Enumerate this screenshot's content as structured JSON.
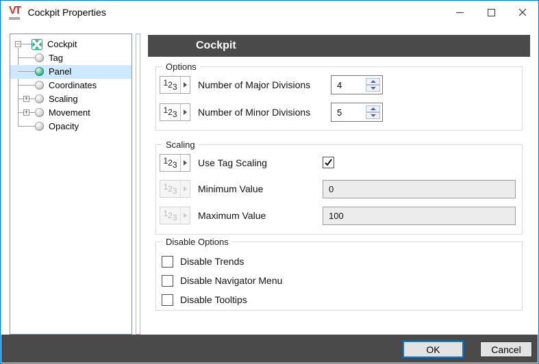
{
  "window": {
    "title": "Cockpit Properties",
    "logo_text": "VT"
  },
  "tree": {
    "root": {
      "label": "Cockpit",
      "expander_glyph": "−"
    },
    "items": [
      {
        "label": "Tag",
        "selected": false
      },
      {
        "label": "Panel",
        "selected": true
      },
      {
        "label": "Coordinates",
        "selected": false
      },
      {
        "label": "Scaling",
        "selected": false,
        "expander_glyph": "+"
      },
      {
        "label": "Movement",
        "selected": false,
        "expander_glyph": "+"
      },
      {
        "label": "Opacity",
        "selected": false
      }
    ]
  },
  "header": {
    "title": "Cockpit"
  },
  "options_group": {
    "label": "Options",
    "rows": [
      {
        "label": "Number of Major Divisions",
        "value": "4"
      },
      {
        "label": "Number of Minor Divisions",
        "value": "5"
      }
    ]
  },
  "scaling_group": {
    "label": "Scaling",
    "use_tag_scaling": {
      "label": "Use Tag Scaling",
      "checked": true
    },
    "minimum": {
      "label": "Minimum Value",
      "value": "0",
      "disabled": true
    },
    "maximum": {
      "label": "Maximum Value",
      "value": "100",
      "disabled": true
    }
  },
  "disable_group": {
    "label": "Disable Options",
    "items": [
      {
        "label": "Disable Trends",
        "checked": false
      },
      {
        "label": "Disable Navigator Menu",
        "checked": false
      },
      {
        "label": "Disable Tooltips",
        "checked": false
      }
    ]
  },
  "footer": {
    "ok_label": "OK",
    "cancel_label": "Cancel"
  },
  "icons": {
    "numeric": {
      "d1": "1",
      "d2": "2",
      "d3": "3"
    }
  },
  "colors": {
    "accent": "#0078d7",
    "header_bg": "#4a4a4a",
    "footer_bg": "#4a4a4a",
    "tree_selection": "#cde8ff",
    "disabled_field_bg": "#ececec",
    "logo_red": "#cf2f27",
    "sphere_green": "#0e8e60"
  }
}
